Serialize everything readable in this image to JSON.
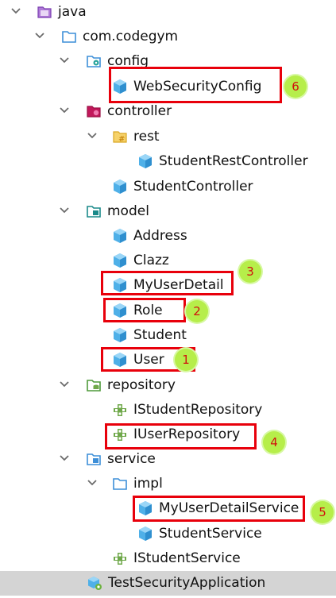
{
  "colors": {
    "highlight_border": "#e8000b",
    "badge_fill": "#b6ee4a",
    "badge_text": "#d0120e",
    "selected_row": "#d4d4d4",
    "class_icon": "#4fb0e8",
    "interface_icon": "#6fa84a"
  },
  "tree": {
    "items": [
      {
        "label": "java",
        "icon": "java-source-folder-icon",
        "expanded": true
      },
      {
        "label": "com.codegym",
        "icon": "package-folder-icon",
        "expanded": true
      },
      {
        "label": "config",
        "icon": "config-folder-icon",
        "expanded": true
      },
      {
        "label": "WebSecurityConfig",
        "icon": "class-icon"
      },
      {
        "label": "controller",
        "icon": "controller-folder-icon",
        "expanded": true
      },
      {
        "label": "rest",
        "icon": "rest-folder-icon",
        "expanded": true
      },
      {
        "label": "StudentRestController",
        "icon": "class-icon"
      },
      {
        "label": "StudentController",
        "icon": "class-icon"
      },
      {
        "label": "model",
        "icon": "model-folder-icon",
        "expanded": true
      },
      {
        "label": "Address",
        "icon": "class-icon"
      },
      {
        "label": "Clazz",
        "icon": "class-icon"
      },
      {
        "label": "MyUserDetail",
        "icon": "class-icon"
      },
      {
        "label": "Role",
        "icon": "class-icon"
      },
      {
        "label": "Student",
        "icon": "class-icon"
      },
      {
        "label": "User",
        "icon": "class-icon"
      },
      {
        "label": "repository",
        "icon": "repository-folder-icon",
        "expanded": true
      },
      {
        "label": "IStudentRepository",
        "icon": "interface-icon"
      },
      {
        "label": "IUserRepository",
        "icon": "interface-icon"
      },
      {
        "label": "service",
        "icon": "service-folder-icon",
        "expanded": true
      },
      {
        "label": "impl",
        "icon": "package-folder-icon",
        "expanded": true
      },
      {
        "label": "MyUserDetailService",
        "icon": "class-icon"
      },
      {
        "label": "StudentService",
        "icon": "class-icon"
      },
      {
        "label": "IStudentService",
        "icon": "interface-icon"
      },
      {
        "label": "TestSecurityApplication",
        "icon": "spring-boot-app-icon",
        "selected": true
      }
    ]
  },
  "annotations": [
    {
      "target": "User",
      "number": "1"
    },
    {
      "target": "Role",
      "number": "2"
    },
    {
      "target": "MyUserDetail",
      "number": "3"
    },
    {
      "target": "IUserRepository",
      "number": "4"
    },
    {
      "target": "MyUserDetailService",
      "number": "5"
    },
    {
      "target": "WebSecurityConfig",
      "number": "6"
    }
  ]
}
